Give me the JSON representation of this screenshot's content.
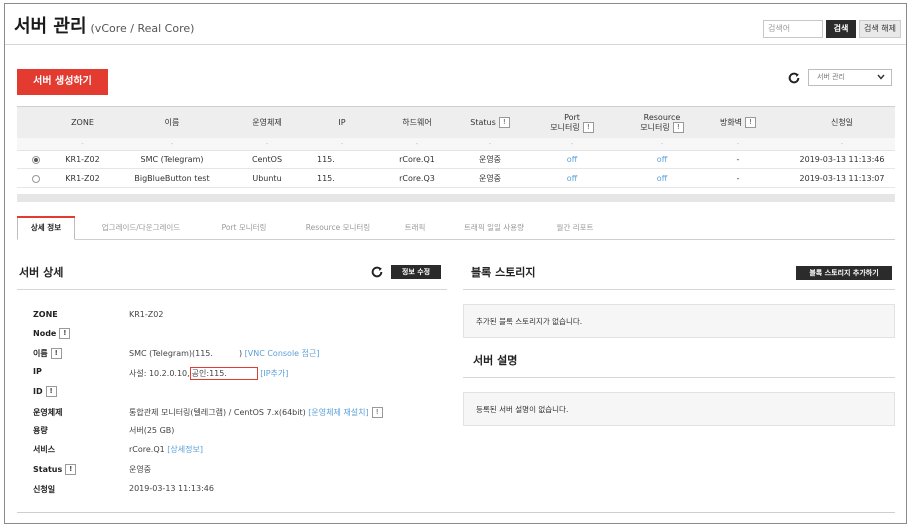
{
  "header": {
    "title": "서버 관리",
    "subtitle": "(vCore / Real Core)",
    "search_placeholder": "검색어",
    "search_label": "검색",
    "clear_label": "검색 해제"
  },
  "toolbar": {
    "create_label": "서버 생성하기",
    "dropdown_value": "서버 관리",
    "dropdown_icon": "chevron-down-icon",
    "refresh_icon": "refresh-icon"
  },
  "table": {
    "columns": {
      "zone": "ZONE",
      "name": "이름",
      "os": "운영체제",
      "ip": "IP",
      "hw": "하드웨어",
      "status": "Status",
      "port1": "Port",
      "port2": "모니터링",
      "resource1": "Resource",
      "resource2": "모니터링",
      "firewall": "방화벽",
      "date": "신청일"
    },
    "filter_placeholder": "-",
    "rows": [
      {
        "selected": true,
        "zone": "KR1-Z02",
        "name": "SMC (Telegram)",
        "os": "CentOS",
        "ip": "115.",
        "hw": "rCore.Q1",
        "status": "운영중",
        "port": "off",
        "resource": "off",
        "firewall": "-",
        "date": "2019-03-13 11:13:46"
      },
      {
        "selected": false,
        "zone": "KR1-Z02",
        "name": "BigBlueButton test",
        "os": "Ubuntu",
        "ip": "115.",
        "hw": "rCore.Q3",
        "status": "운영중",
        "port": "off",
        "resource": "off",
        "firewall": "-",
        "date": "2019-03-13 11:13:07"
      }
    ]
  },
  "tabs": [
    {
      "label": "상세 정보",
      "active": true
    },
    {
      "label": "업그레이드/다운그레이드",
      "active": false
    },
    {
      "label": "Port 모니터링",
      "active": false
    },
    {
      "label": "Resource 모니터링",
      "active": false
    },
    {
      "label": "트래픽",
      "active": false
    },
    {
      "label": "트래픽 일일 사용량",
      "active": false
    },
    {
      "label": "월간 리포트",
      "active": false
    }
  ],
  "detail": {
    "title": "서버 상세",
    "edit_label": "정보 수정",
    "fields": {
      "zone_label": "ZONE",
      "zone_value": "KR1-Z02",
      "node_label": "Node",
      "name_label": "이름",
      "name_value": "SMC (Telegram)(115.",
      "name_suffix": ")",
      "vnc_link": "[VNC Console 접근]",
      "ip_label": "IP",
      "ip_private": "사설: 10.2.0.10,",
      "ip_public": "공인:115.",
      "ip_add_link": "[IP추가]",
      "id_label": "ID",
      "os_label": "운영체제",
      "os_value": "통합관제 모니터링(텔레그램) / CentOS 7.x(64bit)",
      "os_reinstall_link": "[운영체제 재설치]",
      "capacity_label": "용량",
      "capacity_value": "서버(25 GB)",
      "service_label": "서비스",
      "service_value": "rCore.Q1",
      "service_link": "[상세정보]",
      "status_label": "Status",
      "status_value": "운영중",
      "date_label": "신청일",
      "date_value": "2019-03-13 11:13:46"
    },
    "help_mark": "!"
  },
  "storage": {
    "title": "블록 스토리지",
    "add_label": "블록 스토리지 추가하기",
    "empty_message": "추가된 블록 스토리지가 없습니다."
  },
  "description": {
    "title": "서버 설명",
    "empty_message": "등록된 서버 설명이 없습니다."
  },
  "colors": {
    "accent_red": "#e33b30",
    "link_blue": "#5aa0d8",
    "dark_button": "#2b2b2b"
  }
}
